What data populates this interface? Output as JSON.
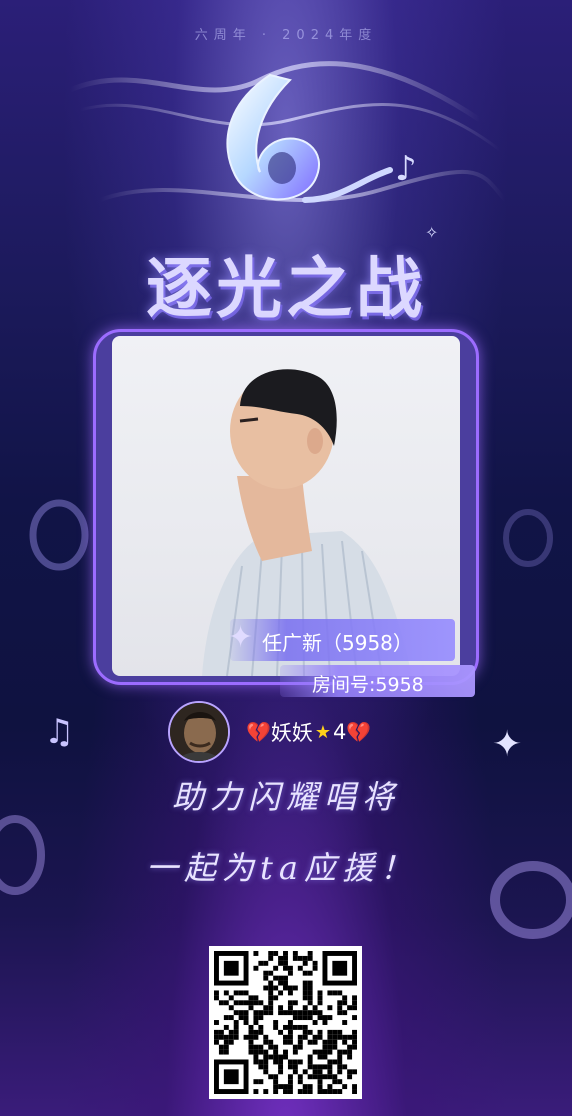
{
  "header": {
    "event_line": "六周年 · 2024年度"
  },
  "title": {
    "main": "逐光之战"
  },
  "singer": {
    "name_label": "任广新（5958）",
    "room_label": "房间号:5958"
  },
  "supporter": {
    "avatar_alt": "avatar",
    "name": "妖妖",
    "level": "4",
    "heart_left": "💔",
    "heart_right": "💔",
    "star": "★"
  },
  "slogan": {
    "line1": "助力闪耀唱将",
    "line2": "一起为ta应援！"
  },
  "qr": {
    "label": "qr-code"
  },
  "colors": {
    "accent": "#9c6cff",
    "background": "#111447",
    "heart": "#e0233a",
    "star": "#ffd11a"
  }
}
